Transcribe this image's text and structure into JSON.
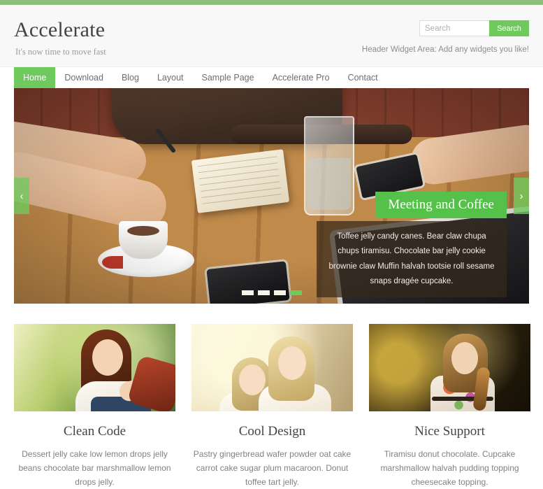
{
  "theme": {
    "accent_green": "#6fca5e",
    "topbar_green": "#8ec07c",
    "caption_green": "#56c14a",
    "header_bg": "#f7f8f7",
    "title_color": "#3f4549"
  },
  "header": {
    "site_title": "Accelerate",
    "site_description": "It's now time to move fast",
    "widget_area_note": "Header Widget Area: Add any widgets you like!"
  },
  "search": {
    "placeholder": "Search",
    "button_label": "Search",
    "value": ""
  },
  "nav": {
    "items": [
      {
        "label": "Home",
        "active": true
      },
      {
        "label": "Download",
        "active": false
      },
      {
        "label": "Blog",
        "active": false
      },
      {
        "label": "Layout",
        "active": false
      },
      {
        "label": "Sample Page",
        "active": false
      },
      {
        "label": "Accelerate Pro",
        "active": false
      },
      {
        "label": "Contact",
        "active": false
      }
    ]
  },
  "slider": {
    "prev_icon": "chevron-left-icon",
    "next_icon": "chevron-right-icon",
    "prev_glyph": "‹",
    "next_glyph": "›",
    "caption_title": "Meeting and Coffee",
    "caption_text": "Toffee jelly candy canes. Bear claw chupa chups tiramisu. Chocolate bar jelly cookie brownie claw Muffin halvah tootsie roll sesame snaps dragée cupcake.",
    "image_alt": "Two people at a wooden cafe table with notebook, coffee cup, glass of water, phones and a tablet",
    "dots": [
      {
        "active": false
      },
      {
        "active": false
      },
      {
        "active": false
      },
      {
        "active": true
      }
    ],
    "active_slide": 4,
    "total_slides": 4
  },
  "features": [
    {
      "title": "Clean Code",
      "text": "Dessert jelly cake low lemon drops jelly beans chocolate bar marshmallow lemon drops jelly.",
      "image_alt": "Smiling woman with long auburn hair in a white top outdoors among green foliage"
    },
    {
      "title": "Cool Design",
      "text": "Pastry gingerbread wafer powder oat cake carrot cake sugar plum macaroon. Donut toffee tart jelly.",
      "image_alt": "Two blonde girls smiling outdoors in warm backlight"
    },
    {
      "title": "Nice Support",
      "text": "Tiramisu donut chocolate. Cupcake marshmallow halvah pudding topping cheesecake topping.",
      "image_alt": "Young girl in a floral dress among dark foliage with golden bokeh lights"
    }
  ]
}
